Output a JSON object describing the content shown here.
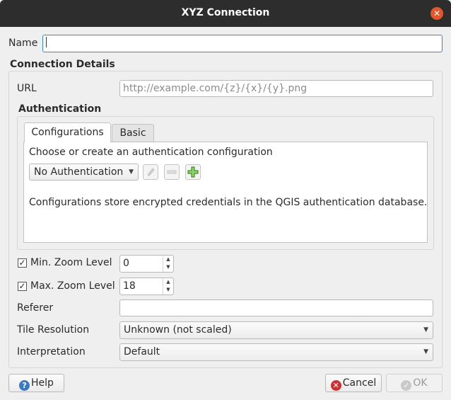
{
  "window": {
    "title": "XYZ Connection",
    "close_glyph": "✕"
  },
  "name": {
    "label": "Name",
    "value": ""
  },
  "connection_details": {
    "heading": "Connection Details",
    "url_label": "URL",
    "url_placeholder": "http://example.com/{z}/{x}/{y}.png"
  },
  "authentication": {
    "heading": "Authentication",
    "tabs": [
      {
        "label": "Configurations",
        "active": true
      },
      {
        "label": "Basic",
        "active": false
      }
    ],
    "choose_text": "Choose or create an authentication configuration",
    "selected_config": "No Authentication",
    "note": "Configurations store encrypted credentials in the QGIS authentication database."
  },
  "min_zoom": {
    "label": "Min. Zoom Level",
    "checked": true,
    "value": "0"
  },
  "max_zoom": {
    "label": "Max. Zoom Level",
    "checked": true,
    "value": "18"
  },
  "referer": {
    "label": "Referer",
    "value": ""
  },
  "tile_resolution": {
    "label": "Tile Resolution",
    "value": "Unknown (not scaled)"
  },
  "interpretation": {
    "label": "Interpretation",
    "value": "Default"
  },
  "buttons": {
    "help": "Help",
    "cancel": "Cancel",
    "ok": "OK"
  },
  "colors": {
    "accent": "#3584e4",
    "titlebar": "#2d2d2d",
    "close": "#e2562a"
  },
  "icons": [
    "close-icon",
    "edit-icon",
    "remove-icon",
    "add-icon",
    "help-icon",
    "cancel-icon",
    "ok-icon"
  ]
}
